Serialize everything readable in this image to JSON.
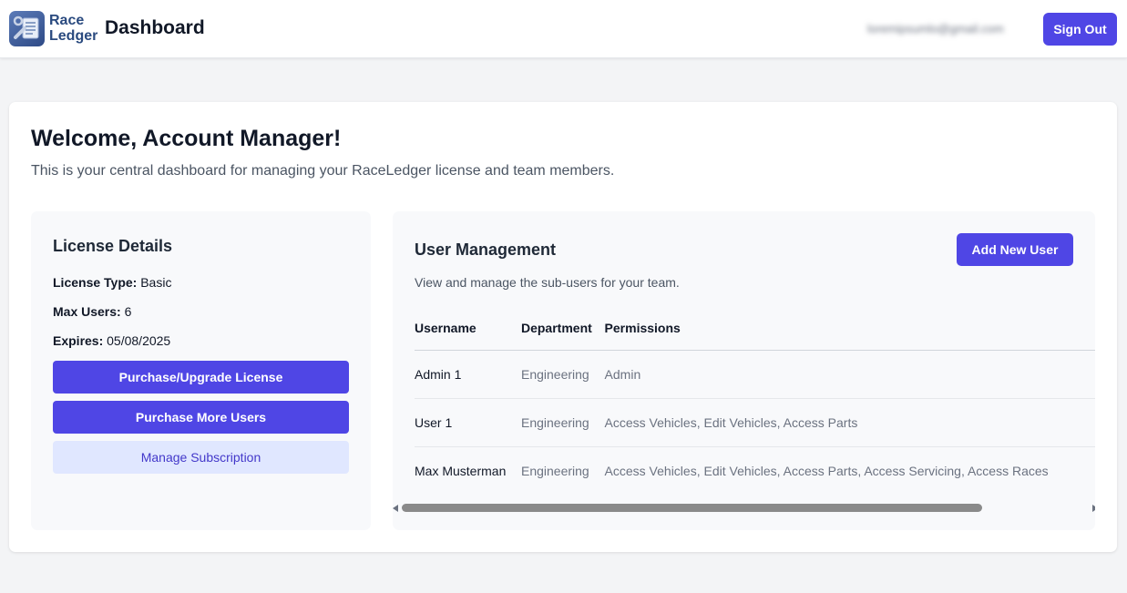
{
  "header": {
    "logo_line1": "Race",
    "logo_line2": "Ledger",
    "title": "Dashboard",
    "user_email": "loremipsumlo@gmail.com",
    "signout_label": "Sign Out"
  },
  "welcome": {
    "title": "Welcome, Account Manager!",
    "subtitle": "This is your central dashboard for managing your RaceLedger license and team members."
  },
  "license": {
    "title": "License Details",
    "type_label": "License Type:",
    "type_value": "Basic",
    "max_users_label": "Max Users:",
    "max_users_value": "6",
    "expires_label": "Expires:",
    "expires_value": "05/08/2025",
    "purchase_upgrade_label": "Purchase/Upgrade License",
    "purchase_more_users_label": "Purchase More Users",
    "manage_subscription_label": "Manage Subscription"
  },
  "users": {
    "title": "User Management",
    "add_user_label": "Add New User",
    "subtitle": "View and manage the sub-users for your team.",
    "columns": [
      "Username",
      "Department",
      "Permissions"
    ],
    "rows": [
      {
        "username": "Admin 1",
        "department": "Engineering",
        "permissions": "Admin"
      },
      {
        "username": "User 1",
        "department": "Engineering",
        "permissions": "Access Vehicles, Edit Vehicles, Access Parts"
      },
      {
        "username": "Max Musterman",
        "department": "Engineering",
        "permissions": "Access Vehicles, Edit Vehicles, Access Parts, Access Servicing, Access Races"
      }
    ]
  },
  "colors": {
    "primary": "#4f46e5",
    "secondary_bg": "#e0e7ff",
    "page_bg": "#f3f4f6"
  }
}
